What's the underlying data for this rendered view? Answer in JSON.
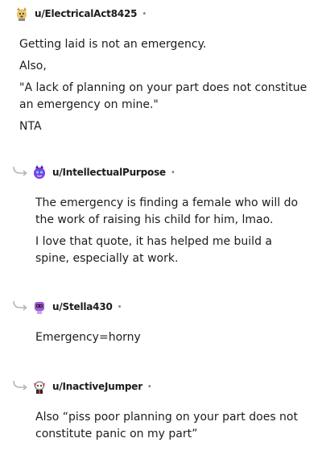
{
  "comments": [
    {
      "username": "u/ElectricalAct8425",
      "separator": "•",
      "avatar_icon": "dog-avatar-icon",
      "paragraphs": [
        "Getting laid is not an emergency.",
        "Also,",
        "\"A lack of planning on your part does not constitue an emergency on mine.\"",
        "NTA"
      ]
    },
    {
      "username": "u/IntellectualPurpose",
      "separator": "•",
      "avatar_icon": "purple-creature-avatar-icon",
      "paragraphs": [
        "The emergency is finding a female who will do the work of raising his child for him, lmao.",
        "I love that quote, it has helped me build a spine, especially at work."
      ]
    },
    {
      "username": "u/Stella430",
      "separator": "•",
      "avatar_icon": "purple-robot-avatar-icon",
      "paragraphs": [
        "Emergency=horny"
      ]
    },
    {
      "username": "u/InactiveJumper",
      "separator": "•",
      "avatar_icon": "red-dragon-avatar-icon",
      "paragraphs": [
        "Also “piss poor planning on your part does not constitute panic on my part”"
      ]
    }
  ],
  "colors": {
    "text": "#1c1c1c",
    "muted": "#7c7c7c",
    "reply_arrow": "#b5b5b5"
  }
}
